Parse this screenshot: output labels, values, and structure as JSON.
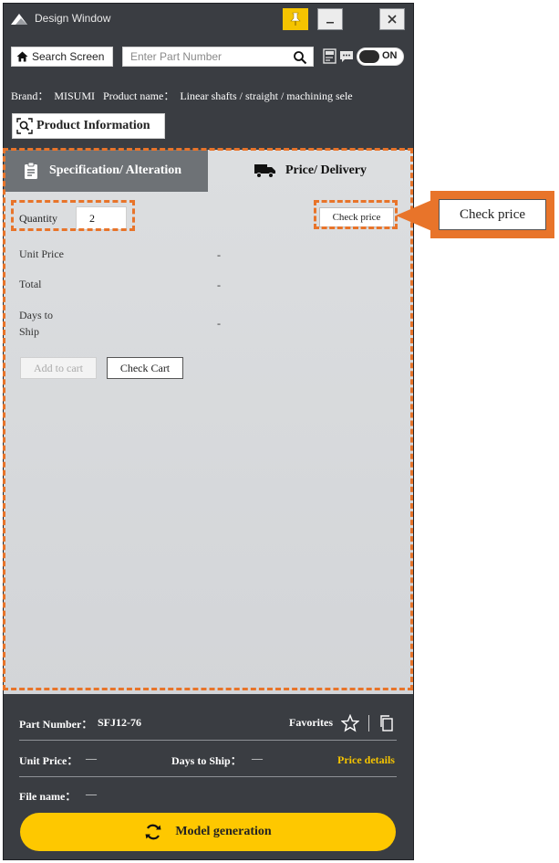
{
  "window": {
    "title": "Design Window"
  },
  "toolbar": {
    "search_screen_label": "Search Screen",
    "part_number_placeholder": "Enter Part Number",
    "toggle_label": "ON"
  },
  "product": {
    "brand_label": "Brand：",
    "brand_value": "MISUMI",
    "name_label": "Product name：",
    "name_value": "Linear shafts / straight / machining sele",
    "info_button_label": "Product Information"
  },
  "tabs": [
    {
      "label": "Specification/ Alteration",
      "active": false
    },
    {
      "label": "Price/ Delivery",
      "active": true
    }
  ],
  "price_panel": {
    "quantity_label": "Quantity",
    "quantity_value": "2",
    "check_price_label": "Check price",
    "rows": [
      {
        "label": "Unit Price",
        "value": "-"
      },
      {
        "label": "Total",
        "value": "-"
      },
      {
        "label": "Days to Ship",
        "value": "-"
      }
    ],
    "add_to_cart_label": "Add to cart",
    "check_cart_label": "Check Cart"
  },
  "footer": {
    "part_number_label": "Part Number：",
    "part_number_value": "SFJ12-76",
    "favorites_label": "Favorites",
    "unit_price_label": "Unit Price：",
    "unit_price_value": "—",
    "days_to_ship_label": "Days to Ship：",
    "days_to_ship_value": "—",
    "price_details_label": "Price details",
    "file_name_label": "File name：",
    "file_name_value": "—",
    "model_generation_label": "Model generation"
  },
  "callout": {
    "label": "Check price"
  },
  "colors": {
    "accent_yellow": "#FEC800",
    "annotation_orange": "#E8742A",
    "window_dark": "#3A3D42"
  }
}
